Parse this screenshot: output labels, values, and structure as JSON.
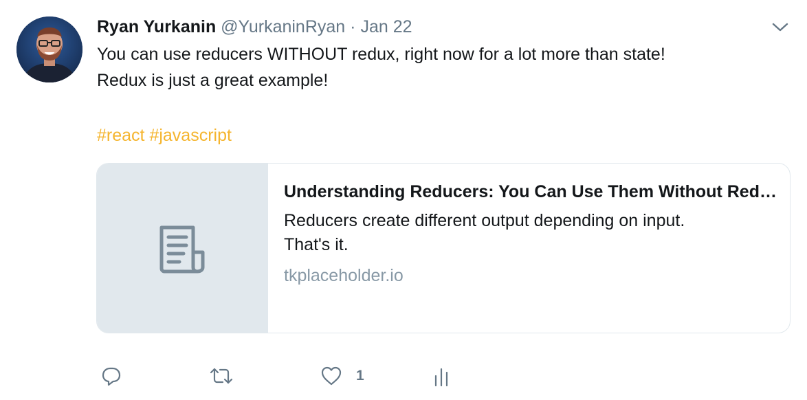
{
  "tweet": {
    "author_name": "Ryan Yurkanin",
    "handle": "@YurkaninRyan",
    "separator": "·",
    "date": "Jan 22",
    "text_line1": "You can use reducers WITHOUT redux, right now for a lot more than state!",
    "text_line2": "Redux is just a great example!",
    "hashtags": [
      "#react",
      "#javascript"
    ]
  },
  "card": {
    "title": "Understanding Reducers: You Can Use Them Without Redux",
    "description_line1": "Reducers create different output depending on input.",
    "description_line2": "That's it.",
    "domain": "tkplaceholder.io",
    "thumbnail_icon": "document-icon"
  },
  "actions": {
    "reply_icon": "reply-icon",
    "retweet_icon": "retweet-icon",
    "like_icon": "heart-icon",
    "like_count": "1",
    "analytics_icon": "analytics-icon"
  },
  "colors": {
    "hashtag": "#f5b52f",
    "muted": "#657786",
    "card_thumb_bg": "#e1e8ed",
    "text": "#14171a"
  }
}
